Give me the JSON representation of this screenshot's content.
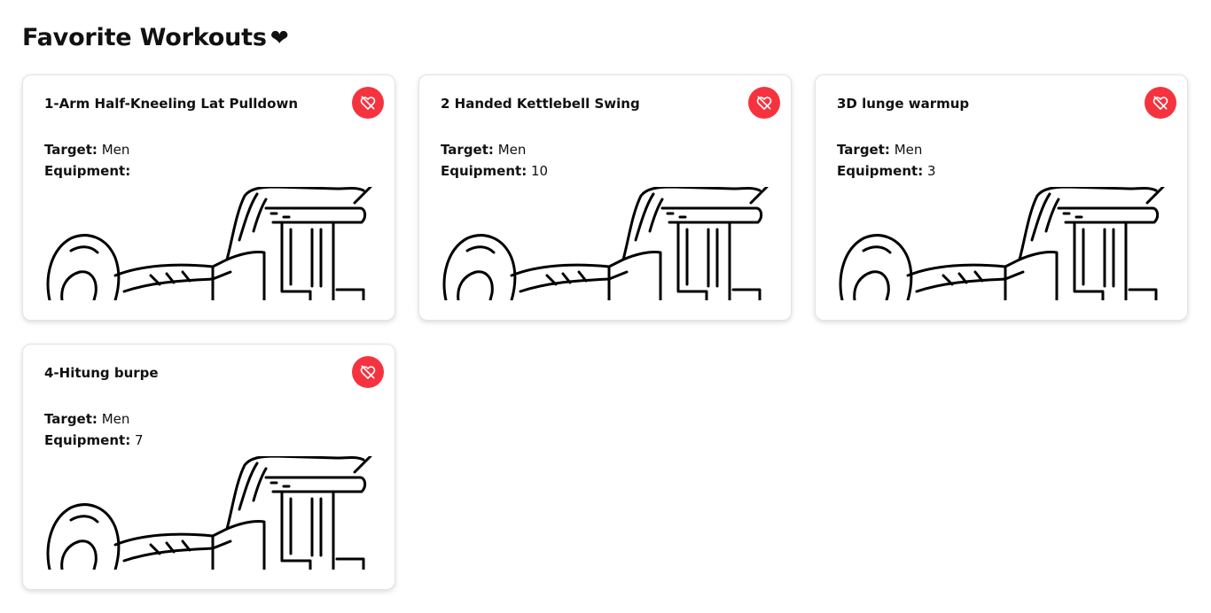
{
  "page": {
    "title": "Favorite Workouts",
    "title_icon": "heart-icon",
    "title_icon_glyph": "❤"
  },
  "labels": {
    "target": "Target:",
    "equipment": "Equipment:"
  },
  "colors": {
    "unfavorite_button": "#f5333f",
    "card_border": "#e3e3e3",
    "text": "#111111"
  },
  "workouts": [
    {
      "name": "1-Arm Half-Kneeling Lat Pulldown",
      "target": "Men",
      "equipment": "",
      "action_icon": "heart-crossed-icon"
    },
    {
      "name": "2 Handed Kettlebell Swing",
      "target": "Men",
      "equipment": "10",
      "action_icon": "heart-crossed-icon"
    },
    {
      "name": "3D lunge warmup",
      "target": "Men",
      "equipment": "3",
      "action_icon": "heart-crossed-icon"
    },
    {
      "name": "4-Hitung burpe",
      "target": "Men",
      "equipment": "7",
      "action_icon": "heart-crossed-icon"
    }
  ]
}
